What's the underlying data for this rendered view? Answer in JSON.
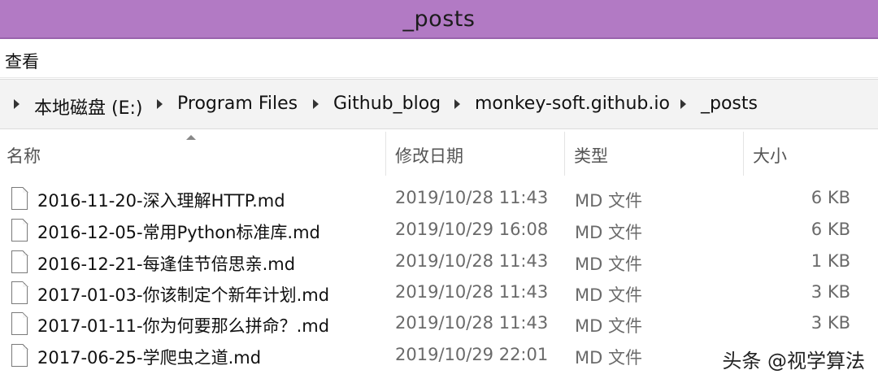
{
  "window": {
    "title": "_posts"
  },
  "menu": {
    "items": [
      "查看"
    ]
  },
  "breadcrumb": [
    "本地磁盘 (E:)",
    "Program Files",
    "Github_blog",
    "monkey-soft.github.io",
    "_posts"
  ],
  "columns": {
    "name": "名称",
    "date": "修改日期",
    "type": "类型",
    "size": "大小"
  },
  "files": [
    {
      "name": "2016-11-20-深入理解HTTP.md",
      "date": "2019/10/28 11:43",
      "type": "MD 文件",
      "size": "6 KB"
    },
    {
      "name": "2016-12-05-常用Python标准库.md",
      "date": "2019/10/29 16:08",
      "type": "MD 文件",
      "size": "6 KB"
    },
    {
      "name": "2016-12-21-每逢佳节倍思亲.md",
      "date": "2019/10/28 11:43",
      "type": "MD 文件",
      "size": "1 KB"
    },
    {
      "name": "2017-01-03-你该制定个新年计划.md",
      "date": "2019/10/28 11:43",
      "type": "MD 文件",
      "size": "3 KB"
    },
    {
      "name": "2017-01-11-你为何要那么拼命？.md",
      "date": "2019/10/28 11:43",
      "type": "MD 文件",
      "size": "3 KB"
    },
    {
      "name": "2017-06-25-学爬虫之道.md",
      "date": "2019/10/29 22:01",
      "type": "MD 文件",
      "size": ""
    }
  ],
  "watermark": "头条 @视学算法",
  "colors": {
    "titlebar": "#b27ac4",
    "addressbar": "#f3f3f3"
  }
}
